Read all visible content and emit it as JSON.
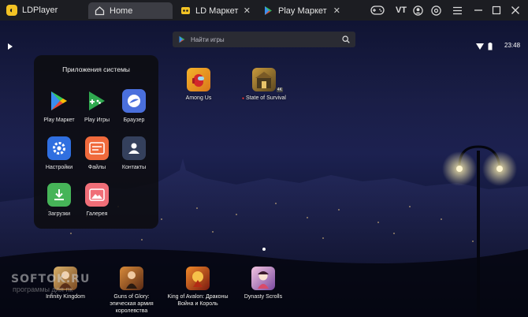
{
  "titlebar": {
    "app_name": "LDPlayer",
    "tabs": [
      {
        "label": "Home",
        "close": "✕",
        "active": true
      },
      {
        "label": "LD Маркет",
        "close": "✕"
      },
      {
        "label": "Play Маркет",
        "close": "✕"
      }
    ],
    "icons": [
      "gamepad-icon",
      "vt-icon",
      "account-icon",
      "settings-icon",
      "menu-icon",
      "minimize-icon",
      "maximize-icon",
      "close-icon"
    ],
    "vt_label": "VT"
  },
  "statusbar": {
    "time": "23:48"
  },
  "search": {
    "placeholder": "Найти игры"
  },
  "folder": {
    "title": "Приложения системы",
    "apps": [
      {
        "label": "Play Маркет",
        "icon": "play-store-icon",
        "color": "#ffffff"
      },
      {
        "label": "Play Игры",
        "icon": "play-games-icon",
        "color": "#2fa84f"
      },
      {
        "label": "Браузер",
        "icon": "browser-icon",
        "color": "#4a6fdc"
      },
      {
        "label": "Настройки",
        "icon": "settings-app-icon",
        "color": "#2f6fe0"
      },
      {
        "label": "Файлы",
        "icon": "files-icon",
        "color": "#f06a3c"
      },
      {
        "label": "Контакты",
        "icon": "contacts-icon",
        "color": "#34405c"
      },
      {
        "label": "Загрузки",
        "icon": "downloads-icon",
        "color": "#46b458"
      },
      {
        "label": "Галерея",
        "icon": "gallery-icon",
        "color": "#f06e78"
      }
    ]
  },
  "desktop_apps": [
    {
      "label": "Among Us",
      "icon": "among-us-icon"
    },
    {
      "label": "State of Survival",
      "icon": "state-of-survival-icon",
      "dot": "●",
      "badge": "4K"
    }
  ],
  "dock_apps": [
    {
      "label": "Infinity Kingdom",
      "icon": "infinity-kingdom-icon"
    },
    {
      "label": "Guns of Glory: эпическая армия королевства",
      "icon": "guns-of-glory-icon"
    },
    {
      "label": "King of Avalon: Драконы Война и Король",
      "icon": "king-of-avalon-icon"
    },
    {
      "label": "Dynasty Scrolls",
      "icon": "dynasty-scrolls-icon"
    }
  ],
  "watermark": {
    "line1": "SOFTOK.RU",
    "line2": "программы для пк"
  }
}
